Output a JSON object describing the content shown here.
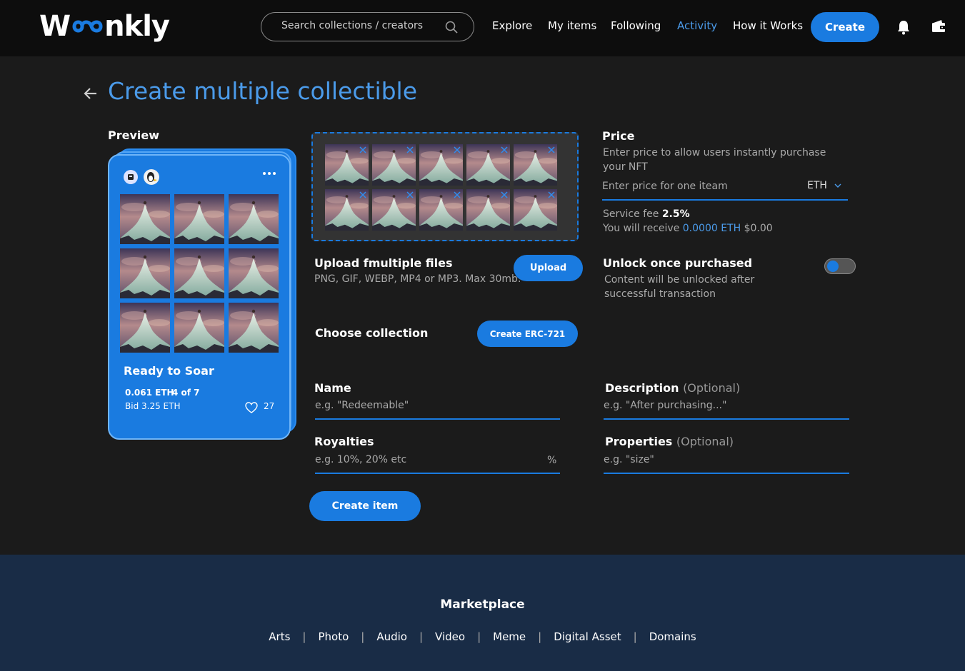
{
  "header": {
    "logo": "Woonkly",
    "search_placeholder": "Search collections / creators",
    "nav": [
      "Explore",
      "My items",
      "Following",
      "Activity",
      "How it Works"
    ],
    "active_nav": "Activity",
    "create_label": "Create",
    "icons": [
      "search-icon",
      "bell-icon",
      "wallet-icon"
    ]
  },
  "page": {
    "title": "Create multiple collectible",
    "preview_label": "Preview"
  },
  "card": {
    "title": "Ready to Soar",
    "price": "0.061 ETH",
    "count": "4 of 7",
    "bid": "Bid 3.25 ETH",
    "likes": "27"
  },
  "upload": {
    "title": "Upload fmultiple files",
    "subtitle": "PNG, GIF, WEBP, MP4 or MP3. Max 30mb.",
    "button": "Upload"
  },
  "collection": {
    "label": "Choose collection",
    "button": "Create ERC-721"
  },
  "price": {
    "title": "Price",
    "description": "Enter price to allow users instantly purchase your NFT",
    "placeholder": "Enter price for one iteam",
    "currency": "ETH",
    "fee_label": "Service fee",
    "fee_value": "2.5%",
    "receive_label": "You will receive",
    "receive_eth": "0.0000 ETH",
    "receive_usd": "$0.00"
  },
  "unlock": {
    "title": "Unlock once purchased",
    "description": "Content will be unlocked after successful transaction",
    "enabled": false
  },
  "fields": {
    "name_label": "Name",
    "name_placeholder": "e.g. \"Redeemable\"",
    "description_label": "Description",
    "description_optional": "(Optional)",
    "description_placeholder": "e.g. \"After purchasing...\"",
    "royalties_label": "Royalties",
    "royalties_placeholder": "e.g. 10%, 20% etc",
    "royalties_unit": "%",
    "properties_label": "Properties",
    "properties_optional": "(Optional)",
    "properties_placeholder": "e.g. \"size\""
  },
  "create_item_button": "Create item",
  "footer": {
    "title": "Marketplace",
    "links": [
      "Arts",
      "Photo",
      "Audio",
      "Video",
      "Meme",
      "Digital Asset",
      "Domains"
    ]
  },
  "colors": {
    "accent": "#1a7be0",
    "link": "#4b9bea",
    "footer_bg": "#192c46"
  }
}
